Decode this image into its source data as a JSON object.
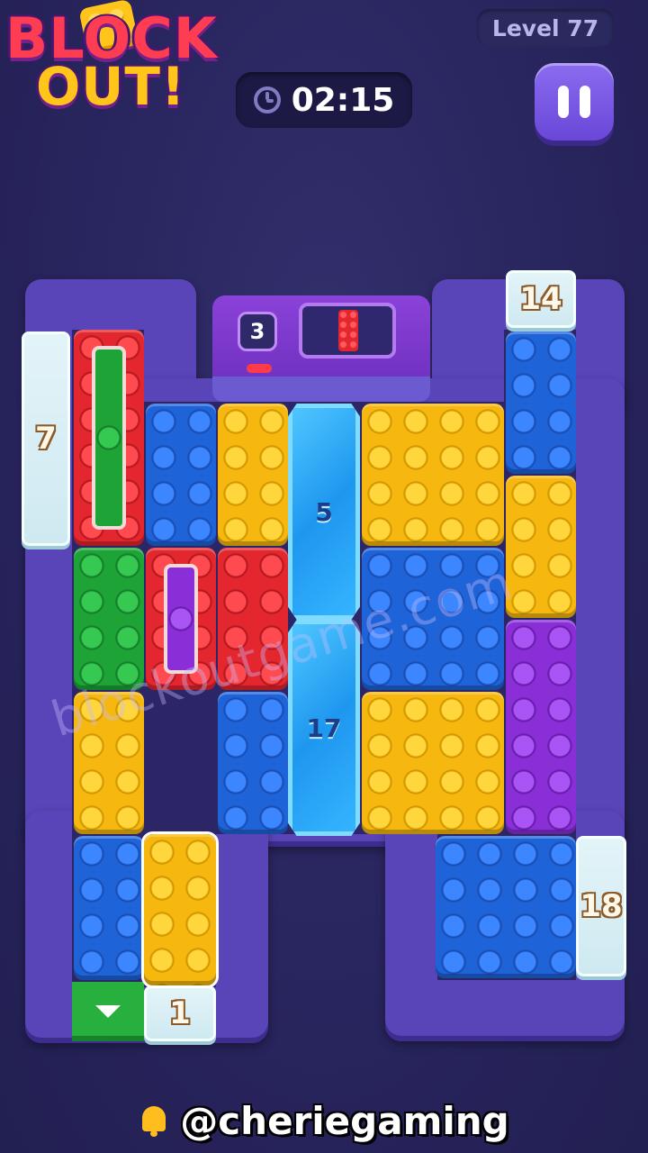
{
  "header": {
    "logo_line1": "BLOCK",
    "logo_line2": "OUT!",
    "level_label": "Level 77",
    "timer": "02:15"
  },
  "board": {
    "machine_counter": "3",
    "gates": {
      "left": "7",
      "top_right": "14",
      "right": "18",
      "bottom": "1"
    },
    "crystals": [
      "5",
      "17"
    ]
  },
  "watermark": "blockoutgame.com",
  "footer": {
    "handle": "@cheriegaming"
  },
  "colors": {
    "yellow": "#f6b80f",
    "blue": "#1f63d8",
    "red": "#e4262e",
    "green": "#1ea436",
    "purple": "#8a2ed8",
    "board": "#5a45b8"
  },
  "icons": [
    "clock-icon",
    "pause-icon",
    "bell-icon",
    "down-arrow-icon"
  ]
}
